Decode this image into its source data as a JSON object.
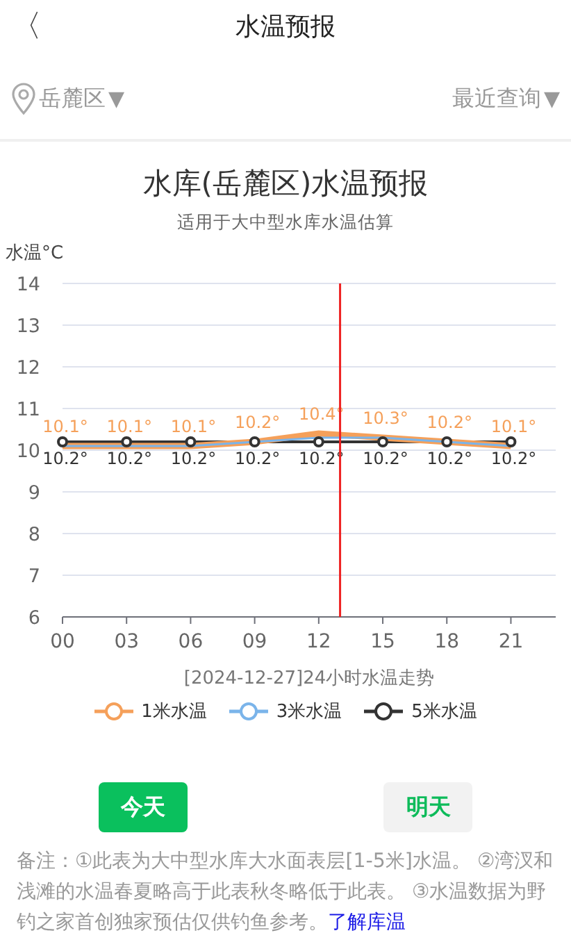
{
  "header": {
    "back_icon": "〈",
    "title": "水温预报"
  },
  "filter_bar": {
    "location": "岳麓区",
    "location_caret": "▼",
    "recent": "最近查询",
    "recent_caret": "▼"
  },
  "chart_title": "水库(岳麓区)水温预报",
  "chart_subtitle": "适用于大中型水库水温估算",
  "chart_data": {
    "type": "line",
    "grid": "y",
    "ylabel": "水温°C",
    "xlabel": "[2024-12-27]24小时水温走势",
    "x": [
      0,
      3,
      6,
      9,
      12,
      15,
      18,
      21
    ],
    "xticks": [
      {
        "value": 0,
        "label": "00"
      },
      {
        "value": 3,
        "label": "03"
      },
      {
        "value": 6,
        "label": "06"
      },
      {
        "value": 9,
        "label": "09"
      },
      {
        "value": 12,
        "label": "12"
      },
      {
        "value": 15,
        "label": "15"
      },
      {
        "value": 18,
        "label": "18"
      },
      {
        "value": 21,
        "label": "21"
      }
    ],
    "xlim": [
      0,
      23.1
    ],
    "ylim": [
      6,
      14
    ],
    "yticks": [
      6,
      7,
      8,
      9,
      10,
      11,
      12,
      13,
      14
    ],
    "series": [
      {
        "name": "1米水温",
        "color": "#f5a05a",
        "marker": "none",
        "values": [
          10.1,
          10.1,
          10.1,
          10.2,
          10.4,
          10.3,
          10.2,
          10.1
        ],
        "value_labels": [
          "10.1°",
          "10.1°",
          "10.1°",
          "10.2°",
          "10.4°",
          "10.3°",
          "10.2°",
          "10.1°"
        ]
      },
      {
        "name": "3米水温",
        "color": "#7ab4ea",
        "marker": "none",
        "values": [
          10.1,
          10.1,
          10.1,
          10.2,
          10.3,
          10.3,
          10.2,
          10.1
        ]
      },
      {
        "name": "5米水温",
        "color": "#333333",
        "marker": "circle",
        "values": [
          10.2,
          10.2,
          10.2,
          10.2,
          10.2,
          10.2,
          10.2,
          10.2
        ],
        "value_labels": [
          "10.2°",
          "10.2°",
          "10.2°",
          "10.2°",
          "10.2°",
          "10.2°",
          "10.2°",
          "10.2°"
        ]
      }
    ],
    "ref_lines": [
      {
        "axis": "x",
        "value": 13,
        "color": "#ee2222"
      }
    ]
  },
  "day_tabs": [
    {
      "label": "今天",
      "selected": true
    },
    {
      "label": "明天",
      "selected": false
    }
  ],
  "note": {
    "text": "备注：①此表为大中型水库大水面表层[1-5米]水温。 ②湾汊和浅滩的水温春夏略高于此表秋冬略低于此表。 ③水温数据为野钓之家首创独家预估仅供钓鱼参考。",
    "link": "了解库温"
  }
}
